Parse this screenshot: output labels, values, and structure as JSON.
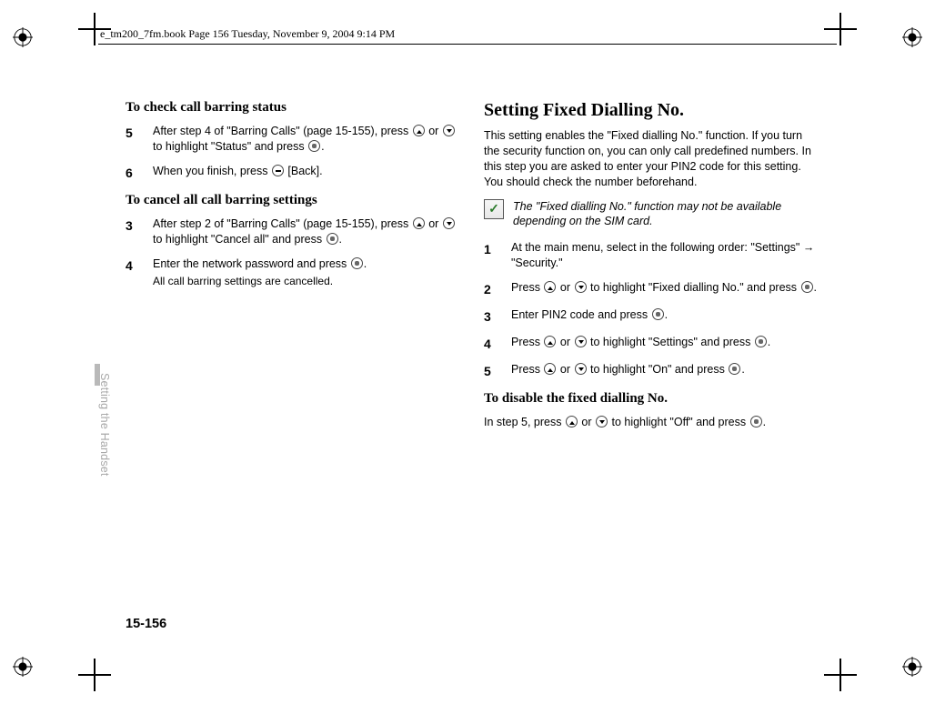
{
  "header": "e_tm200_7fm.book  Page 156  Tuesday, November 9, 2004  9:14 PM",
  "tabLabel": "Setting the Handset",
  "pageNum": "15-156",
  "left": {
    "h1": "To check call barring status",
    "s5n": "5",
    "s5": "After step 4 of \"Barring Calls\" (page 15-155), press ⬚ or ⬚ to highlight \"Status\" and press ⬚.",
    "s6n": "6",
    "s6": "When you finish, press ⬚ [Back].",
    "h2": "To cancel all call barring settings",
    "s3n": "3",
    "s3": "After step 2 of \"Barring Calls\" (page 15-155), press ⬚ or ⬚ to highlight \"Cancel all\" and press ⬚.",
    "s4n": "4",
    "s4": "Enter the network password and press ⬚.",
    "s4sub": "All call barring settings are cancelled."
  },
  "right": {
    "h1": "Setting Fixed Dialling No.",
    "intro": "This setting enables the \"Fixed dialling No.\" function. If you turn the security function on, you can only call predefined numbers. In this step you are asked to enter your PIN2 code for this setting. You should check the number beforehand.",
    "note": "The \"Fixed dialling No.\" function may not be available depending on the SIM card.",
    "s1n": "1",
    "s1a": "At the main menu, select in the following order: \"Settings\" ",
    "s1b": " \"Security.\"",
    "s2n": "2",
    "s2": "Press ⬚ or ⬚ to highlight \"Fixed dialling No.\" and press ⬚.",
    "s3n": "3",
    "s3": "Enter PIN2 code and press ⬚.",
    "s4n": "4",
    "s4": "Press ⬚ or ⬚ to highlight \"Settings\" and press ⬚.",
    "s5n": "5",
    "s5": "Press ⬚ or ⬚ to highlight \"On\" and press ⬚.",
    "h2": "To disable the fixed dialling No.",
    "sub": "In step 5, press ⬚ or ⬚ to highlight \"Off\" and press ⬚."
  }
}
